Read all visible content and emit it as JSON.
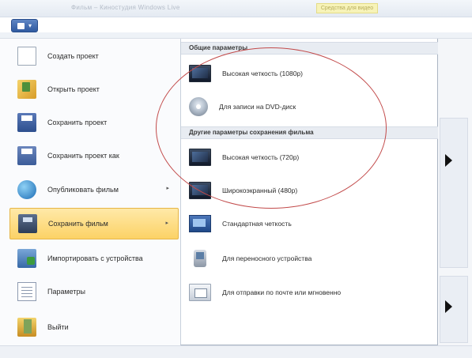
{
  "window": {
    "title": "Фильм – Киностудия Windows Live",
    "badge": "Средства для видео"
  },
  "left_menu": {
    "items": [
      {
        "label": "Создать проект",
        "icon": "new-project-icon",
        "submenu": false
      },
      {
        "label": "Открыть проект",
        "icon": "open-project-icon",
        "submenu": false
      },
      {
        "label": "Сохранить проект",
        "icon": "save-project-icon",
        "submenu": false
      },
      {
        "label": "Сохранить проект как",
        "icon": "save-as-icon",
        "submenu": false
      },
      {
        "label": "Опубликовать фильм",
        "icon": "globe-icon",
        "submenu": true,
        "arrow": "▸"
      },
      {
        "label": "Сохранить фильм",
        "icon": "save-movie-icon",
        "submenu": true,
        "arrow": "▸",
        "active": true
      },
      {
        "label": "Импортировать с устройства",
        "icon": "import-icon",
        "submenu": false
      },
      {
        "label": "Параметры",
        "icon": "options-icon",
        "submenu": false
      },
      {
        "label": "Выйти",
        "icon": "exit-icon",
        "submenu": false
      }
    ]
  },
  "submenu": {
    "section_common": "Общие параметры",
    "section_other": "Другие параметры сохранения фильма",
    "items": [
      {
        "label": "Высокая четкость (1080p)",
        "icon": "monitor-icon"
      },
      {
        "label": "Для записи на DVD-диск",
        "icon": "dvd-icon"
      },
      {
        "label": "Высокая четкость (720p)",
        "icon": "monitor-icon"
      },
      {
        "label": "Широкоэкранный (480p)",
        "icon": "monitor-icon"
      },
      {
        "label": "Стандартная четкость",
        "icon": "computer-icon"
      },
      {
        "label": "Для переносного устройства",
        "icon": "portable-device-icon"
      },
      {
        "label": "Для отправки по почте или мгновенно",
        "icon": "email-icon"
      }
    ]
  },
  "colors": {
    "active_item": "#fcd266",
    "annotation": "#c24a4a",
    "app_button": "#2f5aa0"
  }
}
